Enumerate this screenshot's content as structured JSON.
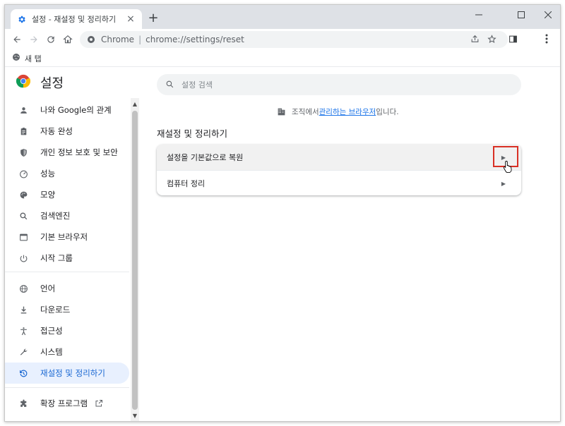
{
  "tab": {
    "title": "설정 - 재설정 및 정리하기",
    "close": "×",
    "new_tab": "+"
  },
  "toolbar": {
    "site_label": "Chrome",
    "separator": "|",
    "url": "chrome://settings/reset"
  },
  "bookmarks": {
    "items": [
      {
        "label": "새 탭",
        "icon": "globe-icon"
      }
    ]
  },
  "settings": {
    "title": "설정",
    "search_placeholder": "설정 검색",
    "sidebar": [
      {
        "label": "나와 Google의 관계",
        "icon": "person-icon"
      },
      {
        "label": "자동 완성",
        "icon": "clipboard-icon"
      },
      {
        "label": "개인 정보 보호 및 보안",
        "icon": "shield-icon"
      },
      {
        "label": "성능",
        "icon": "speedometer-icon"
      },
      {
        "label": "모양",
        "icon": "palette-icon"
      },
      {
        "label": "검색엔진",
        "icon": "search-icon"
      },
      {
        "label": "기본 브라우저",
        "icon": "browser-icon"
      },
      {
        "label": "시작 그룹",
        "icon": "power-icon"
      },
      {
        "label": "언어",
        "icon": "globe-icon"
      },
      {
        "label": "다운로드",
        "icon": "download-icon"
      },
      {
        "label": "접근성",
        "icon": "accessibility-icon"
      },
      {
        "label": "시스템",
        "icon": "wrench-icon"
      },
      {
        "label": "재설정 및 정리하기",
        "icon": "reset-icon",
        "active": true
      },
      {
        "label": "확장 프로그램",
        "icon": "puzzle-icon"
      }
    ],
    "managed": {
      "prefix": "조직에서 ",
      "link": "관리하는 브라우저",
      "suffix": "입니다."
    },
    "section_title": "재설정 및 정리하기",
    "rows": [
      {
        "label": "설정을 기본값으로 복원",
        "highlighted": true
      },
      {
        "label": "컴퓨터 정리",
        "highlighted": false
      }
    ]
  },
  "colors": {
    "accent": "#1a73e8",
    "active_bg": "#e8f0fe",
    "highlight_border": "#d93025"
  }
}
